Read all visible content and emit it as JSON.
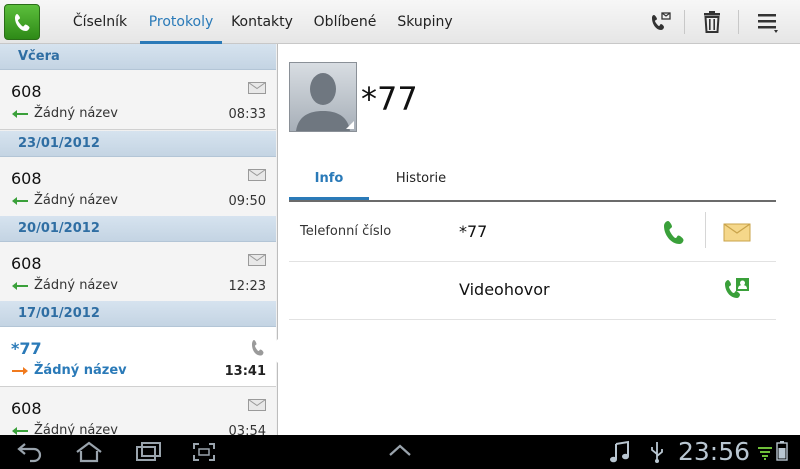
{
  "tabs": [
    {
      "label": "Číselník"
    },
    {
      "label": "Protokoly",
      "active": true
    },
    {
      "label": "Kontakty"
    },
    {
      "label": "Oblíbené"
    },
    {
      "label": "Skupiny"
    }
  ],
  "toolbar_icons": [
    "voicemail-icon",
    "trash-icon",
    "menu-icon"
  ],
  "call_log": {
    "groups": [
      {
        "date": "Včera",
        "entries": [
          {
            "number": "608",
            "name": "Žádný název",
            "time": "08:33",
            "direction": "incoming",
            "type": "message"
          }
        ]
      },
      {
        "date": "23/01/2012",
        "entries": [
          {
            "number": "608",
            "name": "Žádný název",
            "time": "09:50",
            "direction": "incoming",
            "type": "message"
          }
        ]
      },
      {
        "date": "20/01/2012",
        "entries": [
          {
            "number": "608",
            "name": "Žádný název",
            "time": "12:23",
            "direction": "incoming",
            "type": "message"
          }
        ]
      },
      {
        "date": "17/01/2012",
        "entries": [
          {
            "number": "*77",
            "name": "Žádný název",
            "time": "13:41",
            "direction": "outgoing",
            "type": "call",
            "selected": true
          },
          {
            "number": "608",
            "name": "Žádný název",
            "time": "03:54",
            "direction": "incoming",
            "type": "message"
          }
        ]
      }
    ]
  },
  "detail": {
    "name": "*77",
    "tabs": [
      {
        "label": "Info",
        "active": true
      },
      {
        "label": "Historie"
      }
    ],
    "rows": [
      {
        "label": "Telefonní číslo",
        "value": "*77"
      },
      {
        "label": "",
        "value": "Videohovor"
      }
    ]
  },
  "system_bar": {
    "time": "23:56"
  },
  "colors": {
    "accent": "#2a7ab8",
    "incoming_arrow": "#3aa03a",
    "outgoing_arrow": "#f07a1e",
    "call_green": "#3aa03a"
  }
}
